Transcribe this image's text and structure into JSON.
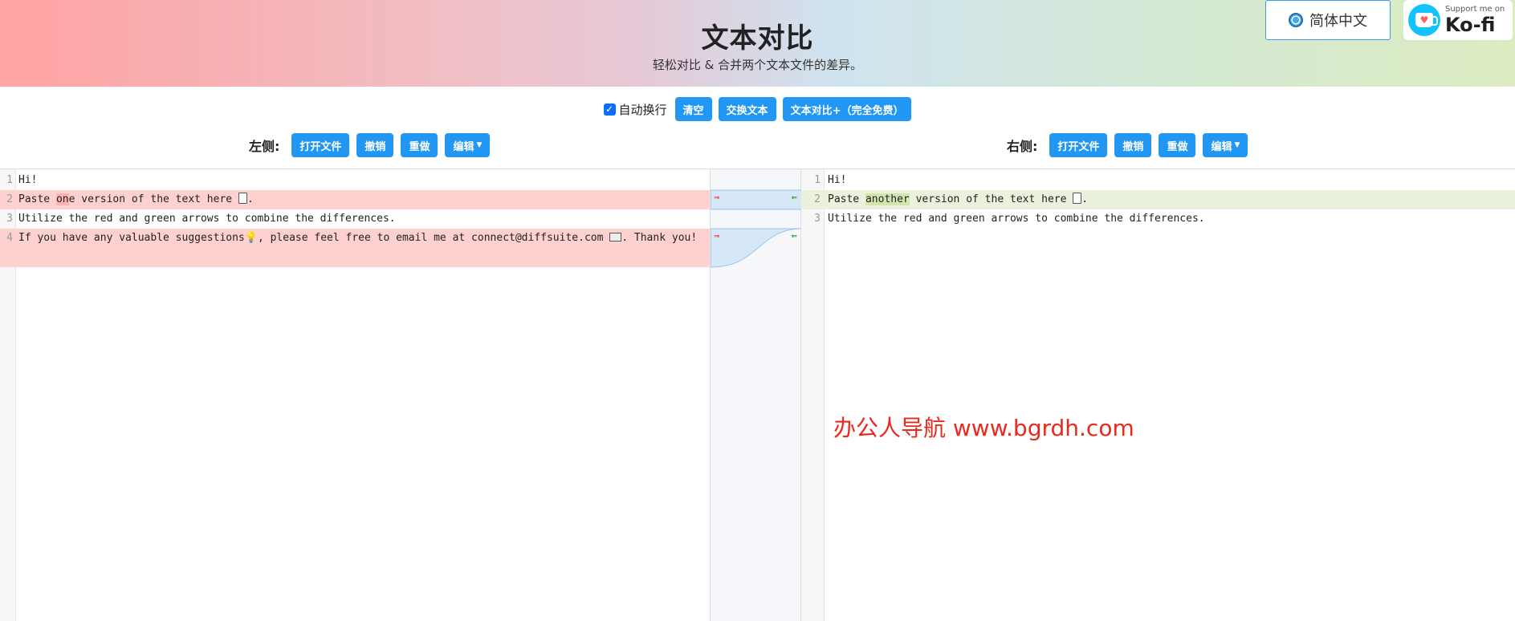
{
  "header": {
    "title": "文本对比",
    "subtitle": "轻松对比 & 合并两个文本文件的差异。",
    "language_button": "简体中文",
    "kofi_small": "Support me on",
    "kofi_big": "Ko-fi"
  },
  "toolbar": {
    "auto_wrap_label": "自动换行",
    "auto_wrap_checked": true,
    "clear_label": "清空",
    "swap_label": "交换文本",
    "plus_label": "文本对比+（完全免费）"
  },
  "left_toolbar": {
    "label": "左侧:",
    "open_label": "打开文件",
    "undo_label": "撤销",
    "redo_label": "重做",
    "edit_label": "编辑"
  },
  "right_toolbar": {
    "label": "右侧:",
    "open_label": "打开文件",
    "undo_label": "撤销",
    "redo_label": "重做",
    "edit_label": "编辑"
  },
  "left_editor": {
    "lines": [
      {
        "num": "1",
        "text": "Hi!"
      },
      {
        "num": "2",
        "pre": "Paste ",
        "hl": "on",
        "post": "e version of the text here "
      },
      {
        "num": "3",
        "text": "Utilize the red and green arrows to combine the differences."
      },
      {
        "num": "4",
        "pre": "If you have any valuable suggestions",
        "mid": ", please feel free to email me at connect@diffsuite.com ",
        "post": ". Thank you!"
      }
    ]
  },
  "right_editor": {
    "lines": [
      {
        "num": "1",
        "text": "Hi!"
      },
      {
        "num": "2",
        "pre": "Paste ",
        "hl": "another",
        "post": " version of the text here "
      },
      {
        "num": "3",
        "text": "Utilize the red and green arrows to combine the differences."
      }
    ]
  },
  "merge_arrows": {
    "to_right": "⇒",
    "to_left": "⇐"
  },
  "watermark": "办公人导航  www.bgrdh.com",
  "colors": {
    "button": "#2196f3",
    "deleted_line": "#ffd0d0",
    "added_line": "#eaf1dd",
    "watermark": "#e8291c"
  }
}
